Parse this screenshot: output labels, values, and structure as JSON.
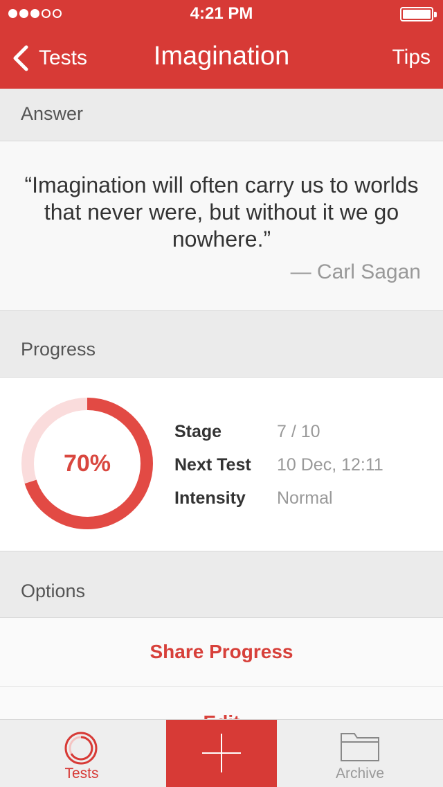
{
  "status_bar": {
    "time": "4:21 PM",
    "signal_bars_filled": 3,
    "signal_bars_total": 5,
    "battery_level": 1.0
  },
  "nav": {
    "back_label": "Tests",
    "title": "Imagination",
    "right_label": "Tips"
  },
  "answer": {
    "section_label": "Answer",
    "quote": "“Imagination will often carry us to worlds that never were, but without it we go nowhere.”",
    "author": "— Carl Sagan"
  },
  "progress": {
    "section_label": "Progress",
    "percent_label": "70%",
    "percent_value": 0.7,
    "stats": [
      {
        "key": "Stage",
        "value": "7 / 10"
      },
      {
        "key": "Next Test",
        "value": "10 Dec, 12:11"
      },
      {
        "key": "Intensity",
        "value": "Normal"
      }
    ]
  },
  "options": {
    "section_label": "Options",
    "items": [
      {
        "label": "Share Progress"
      },
      {
        "label": "Edit"
      }
    ]
  },
  "tab_bar": {
    "tabs": [
      {
        "label": "Tests",
        "icon": "progress-ring-icon",
        "active": true
      },
      {
        "label": "",
        "icon": "plus-icon",
        "active": false
      },
      {
        "label": "Archive",
        "icon": "folder-icon",
        "active": false
      }
    ]
  },
  "colors": {
    "brand_red": "#d73a36",
    "ring_track": "#fadcdc",
    "ring_fill": "#e24a44",
    "muted_text": "#999999",
    "section_bg": "#ebebeb"
  }
}
